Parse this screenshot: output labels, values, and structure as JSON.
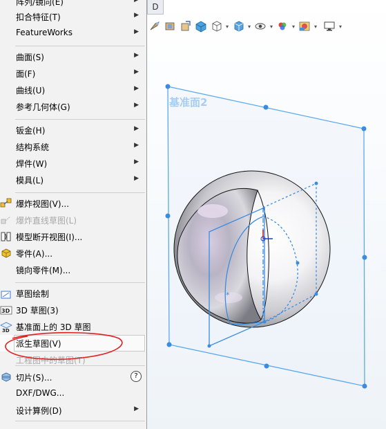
{
  "viewport": {
    "tab_label": "D",
    "plane_label": "基准面2",
    "toolbar": [
      "zoom-fit-icon",
      "zoom-area-icon",
      "previous-view-icon",
      "section-view-icon",
      "view-orientation-icon",
      "display-style-icon",
      "hide-show-items-icon",
      "edit-appearance-icon",
      "apply-scene-icon",
      "view-settings-icon"
    ]
  },
  "menu": {
    "items": [
      {
        "label": "阵列/镜向(E)",
        "arrow": true,
        "disabled": false
      },
      {
        "label": "扣合特征(T)",
        "arrow": true,
        "disabled": false
      },
      {
        "label": "FeatureWorks",
        "arrow": true,
        "disabled": false
      },
      {
        "label": "曲面(S)",
        "arrow": true,
        "disabled": false
      },
      {
        "label": "面(F)",
        "arrow": true,
        "disabled": false
      },
      {
        "label": "曲线(U)",
        "arrow": true,
        "disabled": false
      },
      {
        "label": "参考几何体(G)",
        "arrow": true,
        "disabled": false
      },
      {
        "label": "钣金(H)",
        "arrow": true,
        "disabled": false
      },
      {
        "label": "结构系统",
        "arrow": true,
        "disabled": false
      },
      {
        "label": "焊件(W)",
        "arrow": true,
        "disabled": false
      },
      {
        "label": "模具(L)",
        "arrow": true,
        "disabled": false
      },
      {
        "label": "爆炸视图(V)...",
        "arrow": false,
        "disabled": false,
        "icon": "exploded-view-icon"
      },
      {
        "label": "爆炸直线草图(L)",
        "arrow": false,
        "disabled": true,
        "icon": "explode-line-sketch-icon"
      },
      {
        "label": "模型断开视图(I)...",
        "arrow": false,
        "disabled": false,
        "icon": "model-break-view-icon"
      },
      {
        "label": "零件(A)...",
        "arrow": false,
        "disabled": false,
        "icon": "part-icon"
      },
      {
        "label": "镜向零件(M)...",
        "arrow": false,
        "disabled": false
      },
      {
        "label": "草图绘制",
        "arrow": false,
        "disabled": false,
        "icon": "sketch-icon"
      },
      {
        "label": "3D 草图(3)",
        "arrow": false,
        "disabled": false,
        "icon": "3d-sketch-icon"
      },
      {
        "label": "基准面上的 3D 草图",
        "arrow": false,
        "disabled": false,
        "icon": "3d-sketch-on-plane-icon"
      },
      {
        "label": "派生草图(V)",
        "arrow": false,
        "disabled": false,
        "highlight": true
      },
      {
        "label": "工程图中的草图(T)",
        "arrow": false,
        "disabled": true
      },
      {
        "label": "切片(S)...",
        "arrow": false,
        "disabled": false,
        "icon": "slicing-icon",
        "help": true
      },
      {
        "label": "DXF/DWG...",
        "arrow": false,
        "disabled": false
      },
      {
        "label": "设计算例(D)",
        "arrow": true,
        "disabled": false
      }
    ]
  },
  "colors": {
    "plane": "#5aa8ee",
    "annotation": "#e02020"
  }
}
